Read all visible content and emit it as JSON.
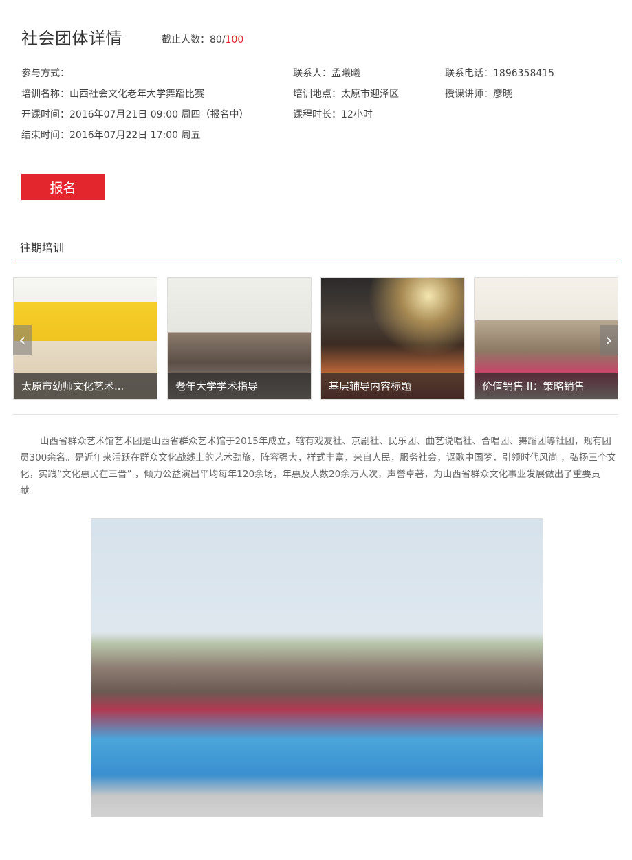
{
  "header": {
    "title": "社会团体详情",
    "quota_label": "截止人数：80/",
    "quota_max": "100"
  },
  "info": {
    "participation": "参与方式：",
    "contact": "联系人：孟曦曦",
    "phone": "联系电话：1896358415",
    "training_name": "培训名称：山西社会文化老年大学舞蹈比赛",
    "location": "培训地点：太原市迎泽区",
    "instructor": "授课讲师：彦晓",
    "start_time": "开课时间：2016年07月21日 09:00 周四（报名中）",
    "duration": "课程时长：12小时",
    "end_time": "结束时间：2016年07月22日 17:00 周五"
  },
  "signup_label": "报名",
  "past": {
    "title": "往期培训",
    "items": [
      {
        "caption": "太原市幼师文化艺术..."
      },
      {
        "caption": "老年大学学术指导"
      },
      {
        "caption": "基层辅导内容标题"
      },
      {
        "caption": "价值销售 II：策略销售"
      }
    ],
    "prev_glyph": "‹",
    "next_glyph": "›"
  },
  "intro": "山西省群众艺术馆艺术团是山西省群众艺术馆于2015年成立，辖有戏友社、京剧社、民乐团、曲艺说唱社、合唱团、舞蹈团等社团，现有团员300余名。是近年来活跃在群众文化战线上的艺术劲旅，阵容强大，样式丰富，来自人民，服务社会，讴歌中国梦，引领时代风尚 ，弘扬三个文化，实践“文化惠民在三晋” ，倾力公益演出平均每年120余场，年惠及人数20余万人次，声誉卓著，为山西省群众文化事业发展做出了重要贡献。"
}
